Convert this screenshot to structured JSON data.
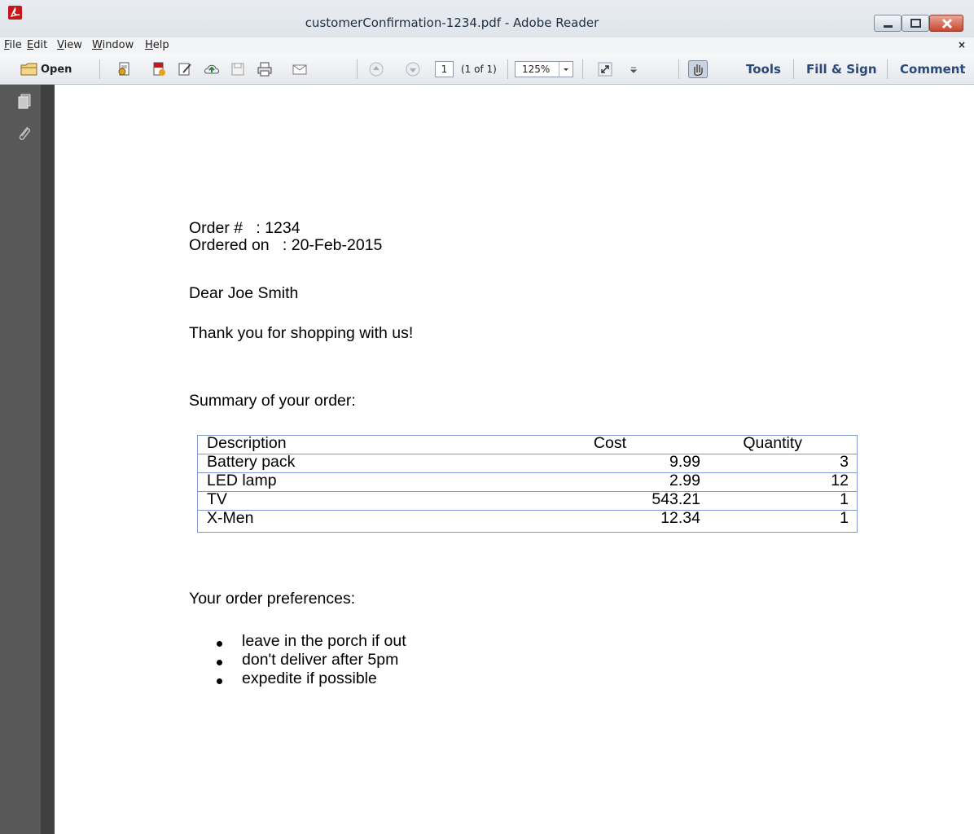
{
  "window": {
    "title": "customerConfirmation-1234.pdf - Adobe Reader"
  },
  "menu": {
    "items": [
      {
        "underline": "F",
        "rest": "ile"
      },
      {
        "underline": "E",
        "rest": "dit"
      },
      {
        "underline": "V",
        "rest": "iew"
      },
      {
        "underline": "W",
        "rest": "indow"
      },
      {
        "underline": "H",
        "rest": "elp"
      }
    ],
    "close_glyph": "×"
  },
  "toolbar": {
    "open_label": "Open",
    "page_value": "1",
    "page_count": "(1 of 1)",
    "zoom": "125%",
    "tools_label": "Tools",
    "fill_sign_label": "Fill & Sign",
    "comment_label": "Comment"
  },
  "colors": {
    "table_border": "#8296d1",
    "link_text": "#29497a"
  },
  "document": {
    "order_line": "Order #   : 1234",
    "ordered_on_line": "Ordered on   : 20-Feb-2015",
    "greeting": "Dear Joe Smith",
    "thanks": "Thank you for shopping with us!",
    "summary_heading": "Summary of your order:",
    "table": {
      "headers": [
        "Description",
        "Cost",
        "Quantity"
      ],
      "rows": [
        [
          "Battery pack",
          "9.99",
          "3"
        ],
        [
          "LED lamp",
          "2.99",
          "12"
        ],
        [
          "TV",
          "543.21",
          "1"
        ],
        [
          "X-Men",
          "12.34",
          "1"
        ]
      ]
    },
    "preferences_heading": "Your order preferences:",
    "preferences": [
      "leave in the porch if out",
      "don't deliver after 5pm",
      "expedite if possible"
    ]
  }
}
